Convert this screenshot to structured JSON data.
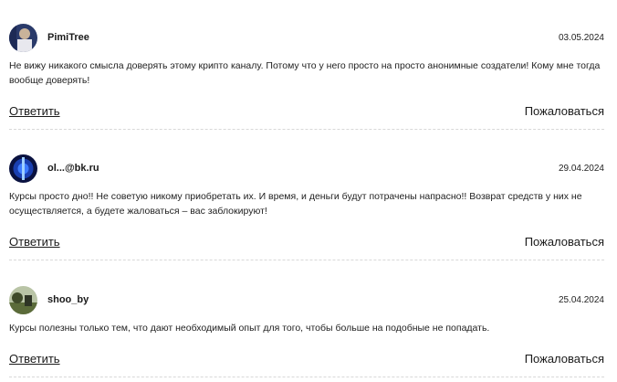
{
  "reviews": [
    {
      "author": "PimiTree",
      "date": "03.05.2024",
      "text": "Не вижу никакого смысла доверять этому крипто каналу. Потому что у него просто на просто анонимные создатели! Кому мне тогда вообще доверять!",
      "reply_label": "Ответить",
      "report_label": "Пожаловаться"
    },
    {
      "author": "ol...@bk.ru",
      "date": "29.04.2024",
      "text": "Курсы просто дно!! Не советую никому приобретать их. И время, и деньги будут потрачены напрасно!! Возврат средств у них не осуществляется, а будете жаловаться – вас заблокируют!",
      "reply_label": "Ответить",
      "report_label": "Пожаловаться"
    },
    {
      "author": "shoo_by",
      "date": "25.04.2024",
      "text": "Курсы полезны только тем, что дают необходимый опыт для того, чтобы больше на подобные не попадать.",
      "reply_label": "Ответить",
      "report_label": "Пожаловаться"
    }
  ]
}
